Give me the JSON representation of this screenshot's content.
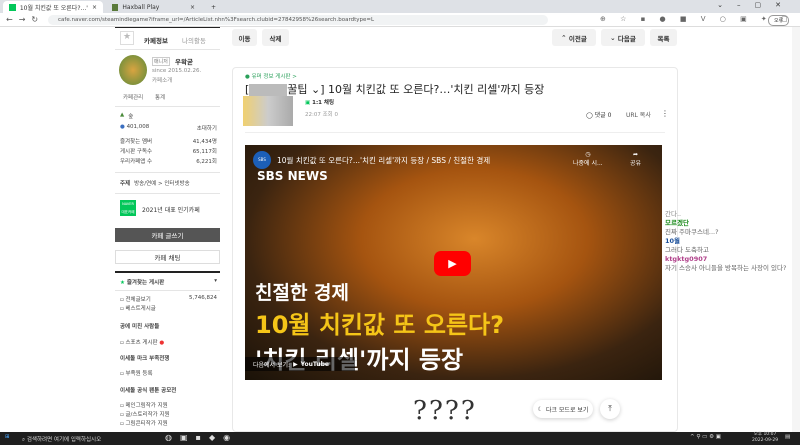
{
  "browser": {
    "tabs": [
      {
        "title": "10월 치킨값 또 오른다?...'치킨 리"
      },
      {
        "title": "Haxball Play"
      }
    ],
    "url": "cafe.naver.com/steamindiegame?iframe_url=/ArticleList.nhn%3Fsearch.clubid=27842958%26search.boardtype=L",
    "profile_label": "오류"
  },
  "sidebar": {
    "tab_cafe_info": "카페정보",
    "tab_my_activity": "나의활동",
    "manager_badge": "매니저",
    "manager_name": "우왁굳",
    "since": "since 2015.02.26.",
    "cafe_intro": "카페소개",
    "cafe_manage": "카페관리",
    "stats": "통계",
    "grade": "숲",
    "members": "401,008",
    "invite": "초대하기",
    "stat_rows": [
      {
        "label": "즐겨찾는 멤버",
        "value": "41,434명"
      },
      {
        "label": "게시판 구독수",
        "value": "65,117회"
      },
      {
        "label": "우리카페앱 수",
        "value": "6,221회"
      }
    ],
    "topic_label": "주제",
    "topic": "방송/연예 > 인터넷방송",
    "naver_badge": "NAVER 대표카페",
    "award": "2021년 대표 인기카페",
    "write_button": "카페 글쓰기",
    "chat_button": "카페 채팅",
    "fav_boards": "즐겨찾는 게시판",
    "boards": [
      {
        "label": "전체글보기",
        "count": "5,746,824"
      },
      {
        "label": "베스트게시글"
      }
    ],
    "section1": "공에 미친 사람들",
    "section1_items": [
      "스포츠 게시판"
    ],
    "section2": "이세돌 마크 부족전쟁",
    "section2_items": [
      "부족원 등록"
    ],
    "section3": "이세돌 공식 팬툰 공모전",
    "section3_items": [
      "메인그림작가 지원",
      "글/스토리작가 지원",
      "그림콘티작가 지원"
    ]
  },
  "main": {
    "move": "이동",
    "delete": "삭제",
    "prev": "이전글",
    "next": "다음글",
    "list": "목록",
    "board": "유머 정보 게시판 >",
    "title_prefix": "꿀팁",
    "title": "] 10월 치킨값 또 오른다?…'치킨 리셀'까지 등장",
    "chat_1to1": "1:1 채팅",
    "meta": "22:07 조회 0",
    "comments": "댓글 0",
    "url_copy": "URL 복사",
    "handwriting": "????",
    "dark_mode": "다크 모드로 보기"
  },
  "video": {
    "channel": "SBS NEWS",
    "title": "10월 치킨값 또 오른다?...'치킨 리셀'까지 등장 / SBS / 친절한 경제",
    "watch_later": "나중에 시...",
    "share": "공유",
    "caption1": "친절한 경제",
    "caption2": "10월 치킨값 또 오른다?",
    "caption3": "'치킨 리셀'까지 등장",
    "watch_on": "다음에서 보기:",
    "youtube": "YouTube"
  },
  "chat": [
    {
      "user": "",
      "msg": "간다.."
    },
    {
      "user": "모르겠단",
      "msg": "진짜 주마쿠스네...?",
      "color": "#1a8a1a"
    },
    {
      "user": "10월",
      "msg": "그러다 도축하고",
      "color": "#1a4f9a"
    },
    {
      "user": "ktgktg0907",
      "msg": "자기 스승사 아니들을 방목하는 사장이 있다?",
      "color": "#b0408a"
    }
  ],
  "taskbar": {
    "search": "검색하려면 여기에 입력하십시오",
    "time": "오후 10:07",
    "date": "2022-09-29"
  }
}
